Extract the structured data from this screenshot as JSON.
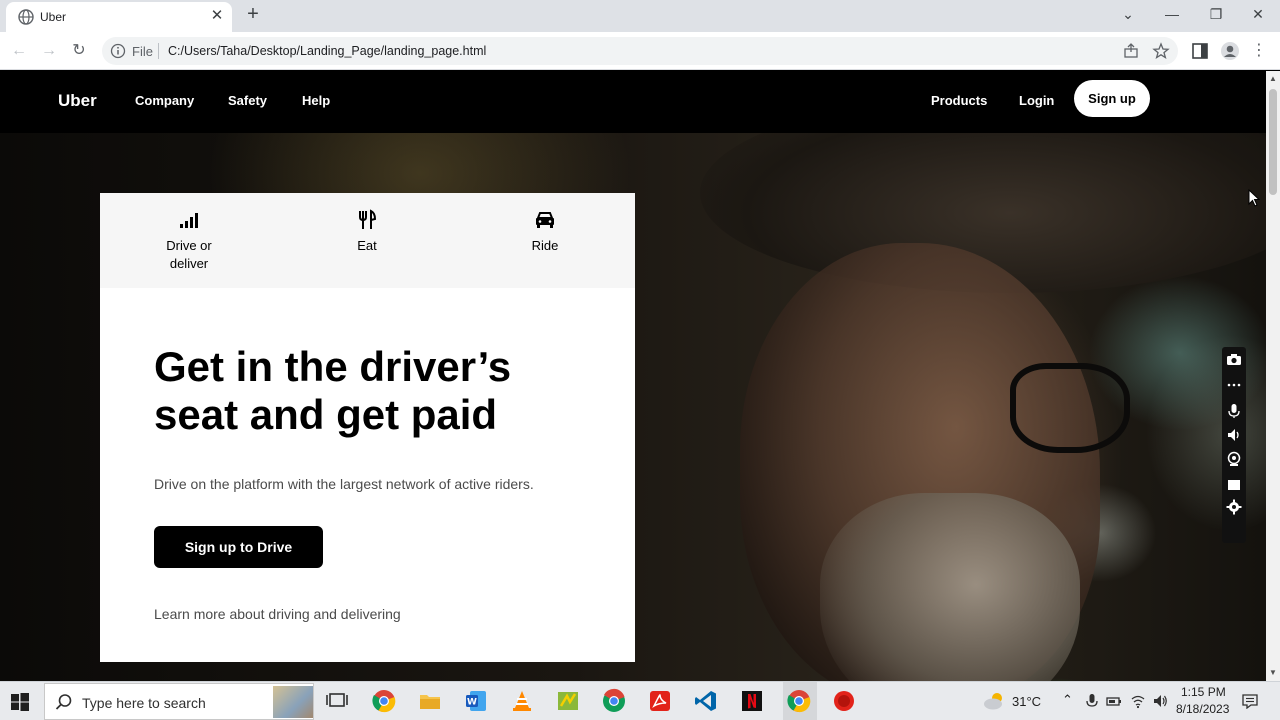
{
  "browser": {
    "tab_title": "Uber",
    "scheme_label": "File",
    "url": "C:/Users/Taha/Desktop/Landing_Page/landing_page.html"
  },
  "site": {
    "brand": "Uber",
    "nav_left": [
      "Company",
      "Safety",
      "Help"
    ],
    "nav_right": {
      "products": "Products",
      "login": "Login",
      "signup": "Sign up"
    }
  },
  "card": {
    "tabs": [
      {
        "label": "Drive or deliver",
        "icon": "signal-bars-icon"
      },
      {
        "label": "Eat",
        "icon": "fork-knife-icon"
      },
      {
        "label": "Ride",
        "icon": "car-icon"
      }
    ],
    "headline": "Get in the driver’s seat and get paid",
    "subtext": "Drive on the platform with the largest network of active riders.",
    "cta": "Sign up to Drive",
    "learn_more": "Learn more about driving and delivering"
  },
  "taskbar": {
    "search_placeholder": "Type here to search",
    "weather": "31°C",
    "time": "1:15 PM",
    "date": "8/18/2023"
  },
  "colors": {
    "page_bg": "#000000",
    "card_bg": "#ffffff",
    "cta_bg": "#000000"
  }
}
